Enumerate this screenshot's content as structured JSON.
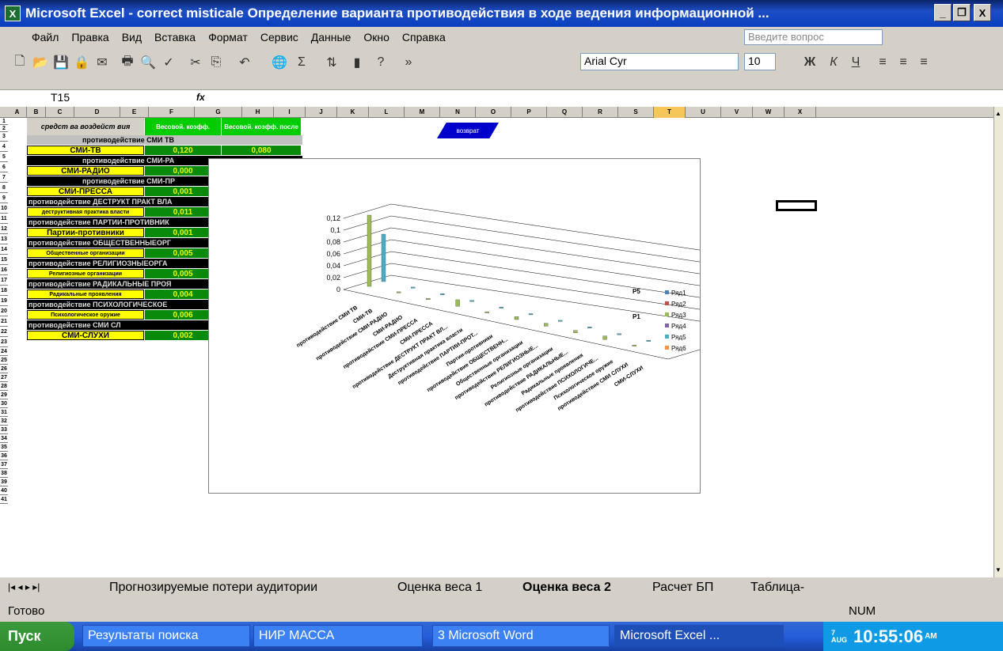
{
  "window": {
    "title": "Microsoft Excel - correct misticale Определение варианта противодействия в ходе ведения информационной ...",
    "minimize": "_",
    "restore": "❐",
    "close": "X"
  },
  "menu": {
    "items": [
      "Файл",
      "Правка",
      "Вид",
      "Вставка",
      "Формат",
      "Сервис",
      "Данные",
      "Окно",
      "Справка"
    ],
    "help_placeholder": "Введите вопрос"
  },
  "toolbar": {
    "font": "Arial Cyr",
    "size": "10",
    "bold": "Ж",
    "italic": "К",
    "underline": "Ч"
  },
  "formula": {
    "name_box": "T15",
    "fx": "fx"
  },
  "columns": [
    "A",
    "B",
    "C",
    "D",
    "E",
    "F",
    "G",
    "H",
    "I",
    "J",
    "K",
    "L",
    "M",
    "N",
    "O",
    "P",
    "Q",
    "R",
    "S",
    "T",
    "U",
    "V",
    "W",
    "X"
  ],
  "rows": [
    "1",
    "2",
    "3",
    "4",
    "5",
    "6",
    "7",
    "8",
    "9",
    "10",
    "11",
    "12",
    "13",
    "14",
    "15",
    "16",
    "17",
    "18",
    "19",
    "20",
    "21",
    "22",
    "23",
    "24",
    "25",
    "26",
    "27",
    "28",
    "29",
    "30",
    "31",
    "32",
    "33",
    "34",
    "35",
    "36",
    "37",
    "38",
    "39",
    "40",
    "41"
  ],
  "sheet": {
    "header_col1": "средст ва воздейст вия",
    "header_col2": "Весовой. коэфф.",
    "header_col3": "Весовой. коэфф. после",
    "return_button": "возврат",
    "rows": [
      {
        "band": "противодействие СМИ ТВ",
        "label": "СМИ-ТВ",
        "val": "0,120",
        "val2": "0,080"
      },
      {
        "band": "противодействие СМИ-РА",
        "label": "СМИ-РАДИО",
        "val": "0,000"
      },
      {
        "band": "противодействие СМИ-ПР",
        "label": "СМИ-ПРЕССА",
        "val": "0,001"
      },
      {
        "band": "противодействие ДЕСТРУКТ ПРАКТ ВЛА",
        "label": "деструктивная практика власти",
        "val": "0,011"
      },
      {
        "band": "противодействие ПАРТИИ-ПРОТИВНИК",
        "label": "Партии-противники",
        "val": "0,001"
      },
      {
        "band": "противодействие ОБЩЕСТВЕННЫЕОРГ",
        "label": "Общественные организации",
        "val": "0,005"
      },
      {
        "band": "противодействие РЕЛИГИОЗНЫЕОРГА",
        "label": "Религиозные организации",
        "val": "0,005"
      },
      {
        "band": "противодействие РАДИКАЛЬНЫЕ ПРОЯ",
        "label": "Радикальные проявления",
        "val": "0,004"
      },
      {
        "band": "противодействие ПСИХОЛОГИЧЕСКОЕ",
        "label": "Психологическое оружие",
        "val": "0,006"
      },
      {
        "band": "противодействие СМИ СЛ",
        "label": "СМИ-СЛУХИ",
        "val": "0,002"
      }
    ]
  },
  "chart_data": {
    "type": "bar",
    "y_ticks": [
      "0,12",
      "0,1",
      "0,08",
      "0,06",
      "0,04",
      "0,02",
      "0"
    ],
    "ylim": [
      0,
      0.12
    ],
    "categories": [
      "противодействие СМИ ТВ",
      "СМИ-ТВ",
      "противодействие СМИ-РАДИО",
      "СМИ-РАДИО",
      "противодействие СМИ-ПРЕССА",
      "СМИ-ПРЕССА",
      "противодействие ДЕСТРУКТ ПРАКТ ВЛ...",
      "Деструктивная практика власти",
      "противодействие ПАРТИИ-ПРОТ...",
      "Партии-противники",
      "противодействие ОБЩЕСТВЕНН...",
      "Общественные организации",
      "противодействие РЕЛИГИОЗНЫЕ...",
      "Религиозные организации",
      "противодействие РАДИКАЛЬНЫЕ...",
      "Радикальные проявления",
      "противодействие ПСИХОЛОГИЧЕ...",
      "Психологическое оружие",
      "противодействие СМИ СЛУХИ",
      "СМИ-СЛУХИ"
    ],
    "depth_labels": [
      "P5",
      "P1"
    ],
    "series": [
      {
        "name": "Ряд1",
        "color": "#4f81bd",
        "values": [
          0,
          0,
          0,
          0,
          0,
          0,
          0,
          0,
          0,
          0
        ]
      },
      {
        "name": "Ряд2",
        "color": "#c0504d",
        "values": [
          0,
          0,
          0,
          0,
          0,
          0,
          0,
          0,
          0,
          0
        ]
      },
      {
        "name": "Ряд3",
        "color": "#9bbb59",
        "values": [
          0.12,
          0,
          0.001,
          0.011,
          0.001,
          0.005,
          0.005,
          0.004,
          0.006,
          0.002
        ]
      },
      {
        "name": "Ряд4",
        "color": "#8064a2",
        "values": [
          0,
          0,
          0,
          0,
          0,
          0,
          0,
          0,
          0,
          0
        ]
      },
      {
        "name": "Ряд5",
        "color": "#4bacc6",
        "values": [
          0.08,
          0,
          0.001,
          0.002,
          0.001,
          0.002,
          0.002,
          0.002,
          0.002,
          0.001
        ]
      },
      {
        "name": "Ряд6",
        "color": "#f79646",
        "values": [
          0,
          0,
          0,
          0,
          0,
          0,
          0,
          0,
          0,
          0
        ]
      }
    ]
  },
  "tabs": [
    "Прогнозируемые потери аудитории",
    "Оценка веса 1",
    "Оценка веса 2",
    "Расчет БП",
    "Таблица-"
  ],
  "status": {
    "ready": "Готово",
    "num": "NUM"
  },
  "taskbar": {
    "start": "Пуск",
    "items": [
      "Результаты поиска",
      "НИР МАССА",
      "3 Microsoft Word",
      "Microsoft Excel ..."
    ],
    "clock": "10:55:06",
    "ampm": "AM",
    "day": "7",
    "month": "AUG"
  }
}
